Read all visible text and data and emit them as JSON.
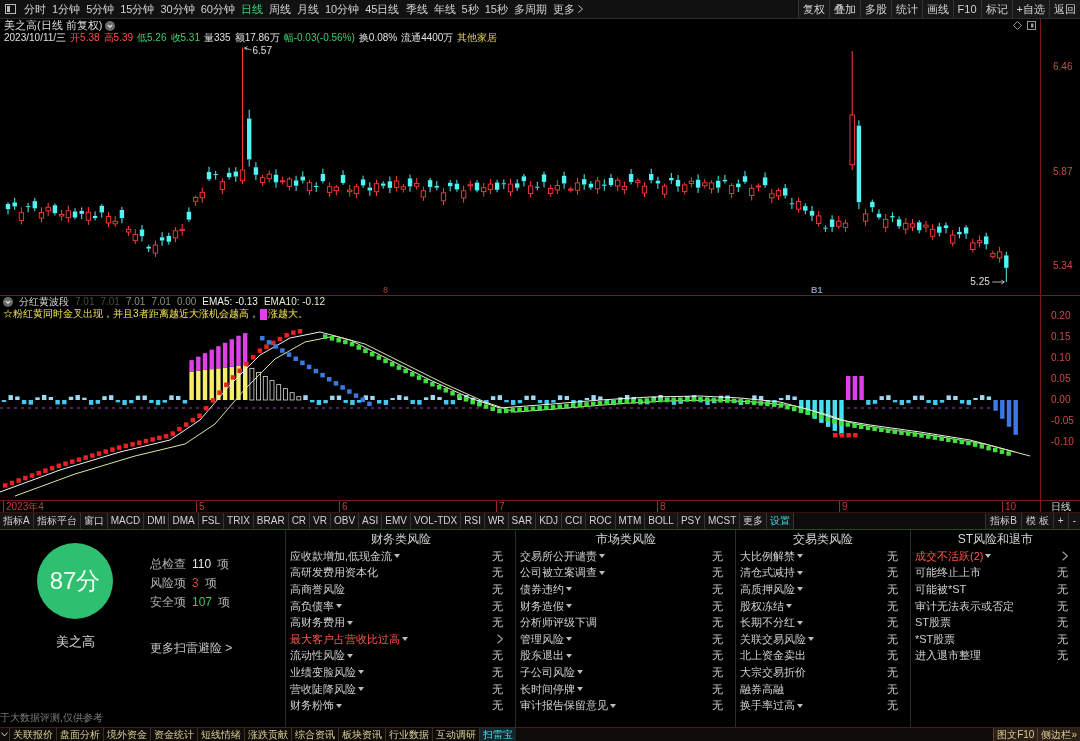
{
  "toolbar": {
    "periods": [
      {
        "label": "分时",
        "selected": false
      },
      {
        "label": "1分钟",
        "selected": false
      },
      {
        "label": "5分钟",
        "selected": false
      },
      {
        "label": "15分钟",
        "selected": false
      },
      {
        "label": "30分钟",
        "selected": false
      },
      {
        "label": "60分钟",
        "selected": false
      },
      {
        "label": "日线",
        "selected": true
      },
      {
        "label": "周线",
        "selected": false
      },
      {
        "label": "月线",
        "selected": false
      },
      {
        "label": "10分钟",
        "selected": false
      },
      {
        "label": "45日线",
        "selected": false
      },
      {
        "label": "季线",
        "selected": false
      },
      {
        "label": "年线",
        "selected": false
      },
      {
        "label": "5秒",
        "selected": false
      },
      {
        "label": "15秒",
        "selected": false
      },
      {
        "label": "多周期",
        "selected": false
      }
    ],
    "more": "更多",
    "actions": [
      "复权",
      "叠加",
      "多股",
      "统计",
      "画线",
      "F10",
      "标记",
      "+自选",
      "返回"
    ]
  },
  "price_chart": {
    "title": "美之高(日线 前复权)",
    "info": [
      {
        "text": "2023/10/11/三",
        "kind": "neutral"
      },
      {
        "text": "开5.38",
        "kind": "up"
      },
      {
        "text": "高5.39",
        "kind": "up"
      },
      {
        "text": "低5.26",
        "kind": "down"
      },
      {
        "text": "收5.31",
        "kind": "down"
      },
      {
        "text": "量335",
        "kind": "neutral"
      },
      {
        "text": "额17.86万",
        "kind": "neutral"
      },
      {
        "text": "幅-0.03(-0.56%)",
        "kind": "down"
      },
      {
        "text": "换0.08%",
        "kind": "neutral"
      },
      {
        "text": "流通4400万",
        "kind": "neutral"
      },
      {
        "text": "其他家居",
        "kind": "sector"
      }
    ],
    "high_label": "6.57",
    "low_label": "5.25",
    "signal_marks": [
      {
        "text": "8",
        "color": "#7a2e2e"
      },
      {
        "text": "B1",
        "color": "#8096b0"
      }
    ],
    "axis_labels": [
      "6.46",
      "5.87",
      "5.34"
    ]
  },
  "indicator": {
    "name": "分红黄波段",
    "values": [
      {
        "text": "7.01",
        "kind": "dim"
      },
      {
        "text": "7.01",
        "kind": "dim"
      },
      {
        "text": "7.01",
        "kind": "plain"
      },
      {
        "text": "7.01",
        "kind": "plain"
      },
      {
        "text": "0.00",
        "kind": "plain"
      },
      {
        "text": "EMA5: -0.13",
        "kind": "bright"
      },
      {
        "text": "EMA10: -0.12",
        "kind": "pale"
      }
    ],
    "note": "☆粉红黄同时金叉出现，并且3者距离越近大涨机会越高，",
    "note_tail": "涨越大。",
    "axis_labels": [
      "0.20",
      "0.15",
      "0.10",
      "0.05",
      "0.00",
      "-0.05",
      "-0.10"
    ]
  },
  "date_axis": {
    "labels": [
      "2023年4",
      "5",
      "6",
      "7",
      "8",
      "9",
      "10"
    ],
    "period": "日线"
  },
  "indicator_tabs": {
    "tabs": [
      {
        "label": "指标A",
        "kind": "indicator",
        "selected": false
      },
      {
        "label": "指标平台",
        "kind": "indicator",
        "selected": false
      },
      {
        "label": "窗口",
        "kind": "indicator",
        "selected": false
      },
      {
        "label": "MACD",
        "kind": "indicator",
        "selected": false
      },
      {
        "label": "DMI",
        "kind": "indicator",
        "selected": false
      },
      {
        "label": "DMA",
        "kind": "indicator",
        "selected": false
      },
      {
        "label": "FSL",
        "kind": "indicator",
        "selected": false
      },
      {
        "label": "TRIX",
        "kind": "indicator",
        "selected": false
      },
      {
        "label": "BRAR",
        "kind": "indicator",
        "selected": false
      },
      {
        "label": "CR",
        "kind": "indicator",
        "selected": false
      },
      {
        "label": "VR",
        "kind": "indicator",
        "selected": false
      },
      {
        "label": "OBV",
        "kind": "indicator",
        "selected": false
      },
      {
        "label": "ASI",
        "kind": "indicator",
        "selected": false
      },
      {
        "label": "EMV",
        "kind": "indicator",
        "selected": false
      },
      {
        "label": "VOL-TDX",
        "kind": "indicator",
        "selected": false
      },
      {
        "label": "RSI",
        "kind": "indicator",
        "selected": false
      },
      {
        "label": "WR",
        "kind": "indicator",
        "selected": false
      },
      {
        "label": "SAR",
        "kind": "indicator",
        "selected": false
      },
      {
        "label": "KDJ",
        "kind": "indicator",
        "selected": false
      },
      {
        "label": "CCI",
        "kind": "indicator",
        "selected": false
      },
      {
        "label": "ROC",
        "kind": "indicator",
        "selected": false
      },
      {
        "label": "MTM",
        "kind": "indicator",
        "selected": false
      },
      {
        "label": "BOLL",
        "kind": "indicator",
        "selected": false
      },
      {
        "label": "PSY",
        "kind": "indicator",
        "selected": false
      },
      {
        "label": "MCST",
        "kind": "indicator",
        "selected": false
      },
      {
        "label": "更多",
        "kind": "indicator",
        "selected": false
      },
      {
        "label": "设置",
        "kind": "settings",
        "selected": false
      }
    ],
    "right_buttons": [
      "指标B",
      "模 板",
      "+",
      "-"
    ]
  },
  "risk_scan": {
    "score": "87分",
    "stock": "美之高",
    "stats": [
      {
        "label": "总检查",
        "value": "110",
        "unit": "项",
        "kind": "total"
      },
      {
        "label": "风险项",
        "value": "3",
        "unit": "项",
        "kind": "risk"
      },
      {
        "label": "安全项",
        "value": "107",
        "unit": "项",
        "kind": "safe"
      }
    ],
    "more_link": "更多扫雷避险 >",
    "disclaimer": "于大数据评测,仅供参考",
    "columns": [
      {
        "title": "财务类风险",
        "rows": [
          {
            "label": "应收款增加,低现金流",
            "expandable": true,
            "risk": false,
            "value": "无"
          },
          {
            "label": "高研发费用资本化",
            "expandable": false,
            "risk": false,
            "value": "无"
          },
          {
            "label": "高商誉风险",
            "expandable": false,
            "risk": false,
            "value": "无"
          },
          {
            "label": "高负债率",
            "expandable": true,
            "risk": false,
            "value": "无"
          },
          {
            "label": "高财务费用",
            "expandable": true,
            "risk": false,
            "value": "无"
          },
          {
            "label": "最大客户占营收比过高",
            "expandable": true,
            "risk": true
          },
          {
            "label": "流动性风险",
            "expandable": true,
            "risk": false,
            "value": "无"
          },
          {
            "label": "业绩变脸风险",
            "expandable": true,
            "risk": false,
            "value": "无"
          },
          {
            "label": "营收陡降风险",
            "expandable": true,
            "risk": false,
            "value": "无"
          },
          {
            "label": "财务粉饰",
            "expandable": true,
            "risk": false,
            "value": "无"
          }
        ]
      },
      {
        "title": "市场类风险",
        "rows": [
          {
            "label": "交易所公开谴责",
            "expandable": true,
            "risk": false,
            "value": "无"
          },
          {
            "label": "公司被立案调查",
            "expandable": true,
            "risk": false,
            "value": "无"
          },
          {
            "label": "债券违约",
            "expandable": true,
            "risk": false,
            "value": "无"
          },
          {
            "label": "财务造假",
            "expandable": true,
            "risk": false,
            "value": "无"
          },
          {
            "label": "分析师评级下调",
            "expandable": false,
            "risk": false,
            "value": "无"
          },
          {
            "label": "管理风险",
            "expandable": true,
            "risk": false,
            "value": "无"
          },
          {
            "label": "股东退出",
            "expandable": true,
            "risk": false,
            "value": "无"
          },
          {
            "label": "子公司风险",
            "expandable": true,
            "risk": false,
            "value": "无"
          },
          {
            "label": "长时间停牌",
            "expandable": true,
            "risk": false,
            "value": "无"
          },
          {
            "label": "审计报告保留意见",
            "expandable": true,
            "risk": false,
            "value": "无"
          }
        ]
      },
      {
        "title": "交易类风险",
        "rows": [
          {
            "label": "大比例解禁",
            "expandable": true,
            "risk": false,
            "value": "无"
          },
          {
            "label": "清仓式减持",
            "expandable": true,
            "risk": false,
            "value": "无"
          },
          {
            "label": "高质押风险",
            "expandable": true,
            "risk": false,
            "value": "无"
          },
          {
            "label": "股权冻结",
            "expandable": true,
            "risk": false,
            "value": "无"
          },
          {
            "label": "长期不分红",
            "expandable": true,
            "risk": false,
            "value": "无"
          },
          {
            "label": "关联交易风险",
            "expandable": true,
            "risk": false,
            "value": "无"
          },
          {
            "label": "北上资金卖出",
            "expandable": false,
            "risk": false,
            "value": "无"
          },
          {
            "label": "大宗交易折价",
            "expandable": false,
            "risk": false,
            "value": "无"
          },
          {
            "label": "融券高融",
            "expandable": false,
            "risk": false,
            "value": "无"
          },
          {
            "label": "换手率过高",
            "expandable": true,
            "risk": false,
            "value": "无"
          }
        ]
      },
      {
        "title": "ST风险和退市",
        "rows": [
          {
            "label": "成交不活跃(2)",
            "expandable": true,
            "risk": true
          },
          {
            "label": "可能终止上市",
            "expandable": false,
            "risk": false,
            "value": "无"
          },
          {
            "label": "可能被*ST",
            "expandable": false,
            "risk": false,
            "value": "无"
          },
          {
            "label": "审计无法表示或否定",
            "expandable": false,
            "risk": false,
            "value": "无"
          },
          {
            "label": "ST股票",
            "expandable": false,
            "risk": false,
            "value": "无"
          },
          {
            "label": "*ST股票",
            "expandable": false,
            "risk": false,
            "value": "无"
          },
          {
            "label": "进入退市整理",
            "expandable": false,
            "risk": false,
            "value": "无"
          }
        ]
      }
    ]
  },
  "status_bar": {
    "tabs": [
      {
        "label": "关联报价",
        "selected": false
      },
      {
        "label": "盘面分析",
        "selected": false
      },
      {
        "label": "境外资金",
        "selected": false
      },
      {
        "label": "资金统计",
        "selected": false
      },
      {
        "label": "短线情绪",
        "selected": false
      },
      {
        "label": "涨跌贡献",
        "selected": false
      },
      {
        "label": "综合资讯",
        "selected": false
      },
      {
        "label": "板块资讯",
        "selected": false
      },
      {
        "label": "行业数据",
        "selected": false
      },
      {
        "label": "互动调研",
        "selected": false
      },
      {
        "label": "扫雷宝",
        "selected": true
      }
    ],
    "side_buttons": [
      "图文F10",
      "侧边栏»"
    ]
  }
}
